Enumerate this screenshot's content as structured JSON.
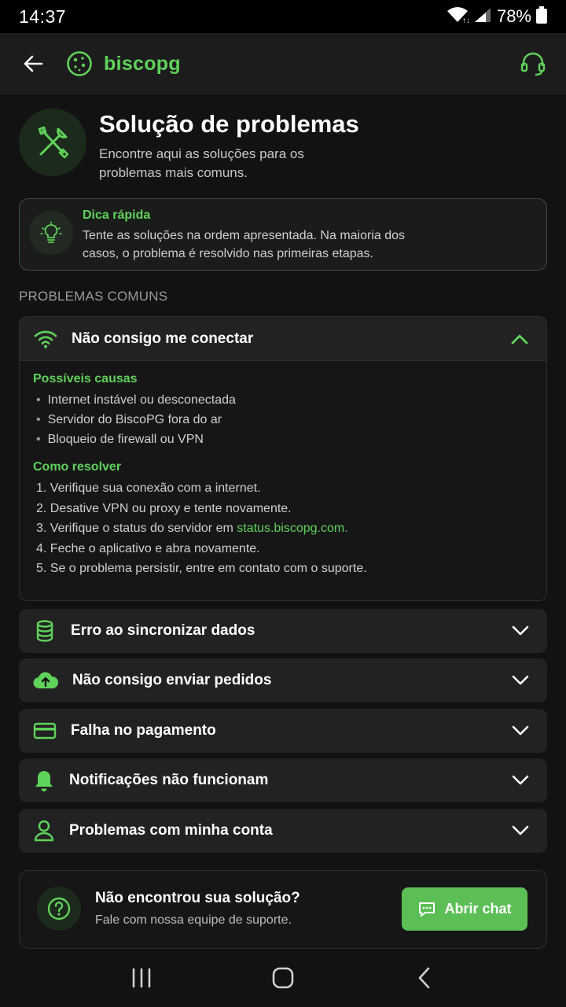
{
  "status_bar": {
    "time": "14:37",
    "battery_percent": "78%",
    "icons": [
      "wifi-icon",
      "signal-icon",
      "battery-icon"
    ]
  },
  "app_bar": {
    "brand_name": "biscopg",
    "back_icon": "arrow-left-icon",
    "logo_icon": "cookie-icon",
    "support_icon": "headset-icon"
  },
  "hero": {
    "title": "Solução de problemas",
    "subtitle": "Encontre aqui as soluções para os problemas mais comuns.",
    "icon": "tools-icon"
  },
  "tip": {
    "title": "Dica rápida",
    "text": "Tente as soluções na ordem apresentada. Na maioria dos casos, o problema é resolvido nas primeiras etapas.",
    "icon": "lightbulb-icon"
  },
  "section_label": "PROBLEMAS COMUNS",
  "open_item": {
    "label": "Não consigo me conectar",
    "icon": "wifi-icon",
    "causes_title": "Possíveis causas",
    "causes": [
      "Internet instável ou desconectada",
      "Servidor do BiscoPG fora do ar",
      "Bloqueio de firewall ou VPN"
    ],
    "steps_title": "Como resolver",
    "steps": [
      "1. Verifique sua conexão com a internet.",
      "2. Desative VPN ou proxy e tente novamente.",
      "3. Verifique o status do servidor em ",
      "4. Feche o aplicativo e abra novamente.",
      "5. Se o problema persistir, entre em contato com o suporte."
    ],
    "status_link": "status.biscopg.com",
    "status_link_suffix": "."
  },
  "items": [
    {
      "label": "Erro ao sincronizar dados",
      "icon": "database-icon"
    },
    {
      "label": "Não consigo enviar pedidos",
      "icon": "cloud-upload-icon"
    },
    {
      "label": "Falha no pagamento",
      "icon": "credit-card-icon"
    },
    {
      "label": "Notificações não funcionam",
      "icon": "bell-icon"
    },
    {
      "label": "Problemas com minha conta",
      "icon": "user-icon"
    }
  ],
  "help": {
    "title": "Não encontrou sua solução?",
    "subtitle": "Fale com nossa equipe de suporte.",
    "button_label": "Abrir chat",
    "icon": "question-circle-icon",
    "button_icon": "chat-bubble-icon"
  },
  "nav": {
    "icons": [
      "recents-icon",
      "home-icon",
      "back-nav-icon"
    ]
  },
  "colors": {
    "accent": "#5fd25a",
    "background": "#121212",
    "card": "#222222",
    "button": "#5cbf56"
  }
}
